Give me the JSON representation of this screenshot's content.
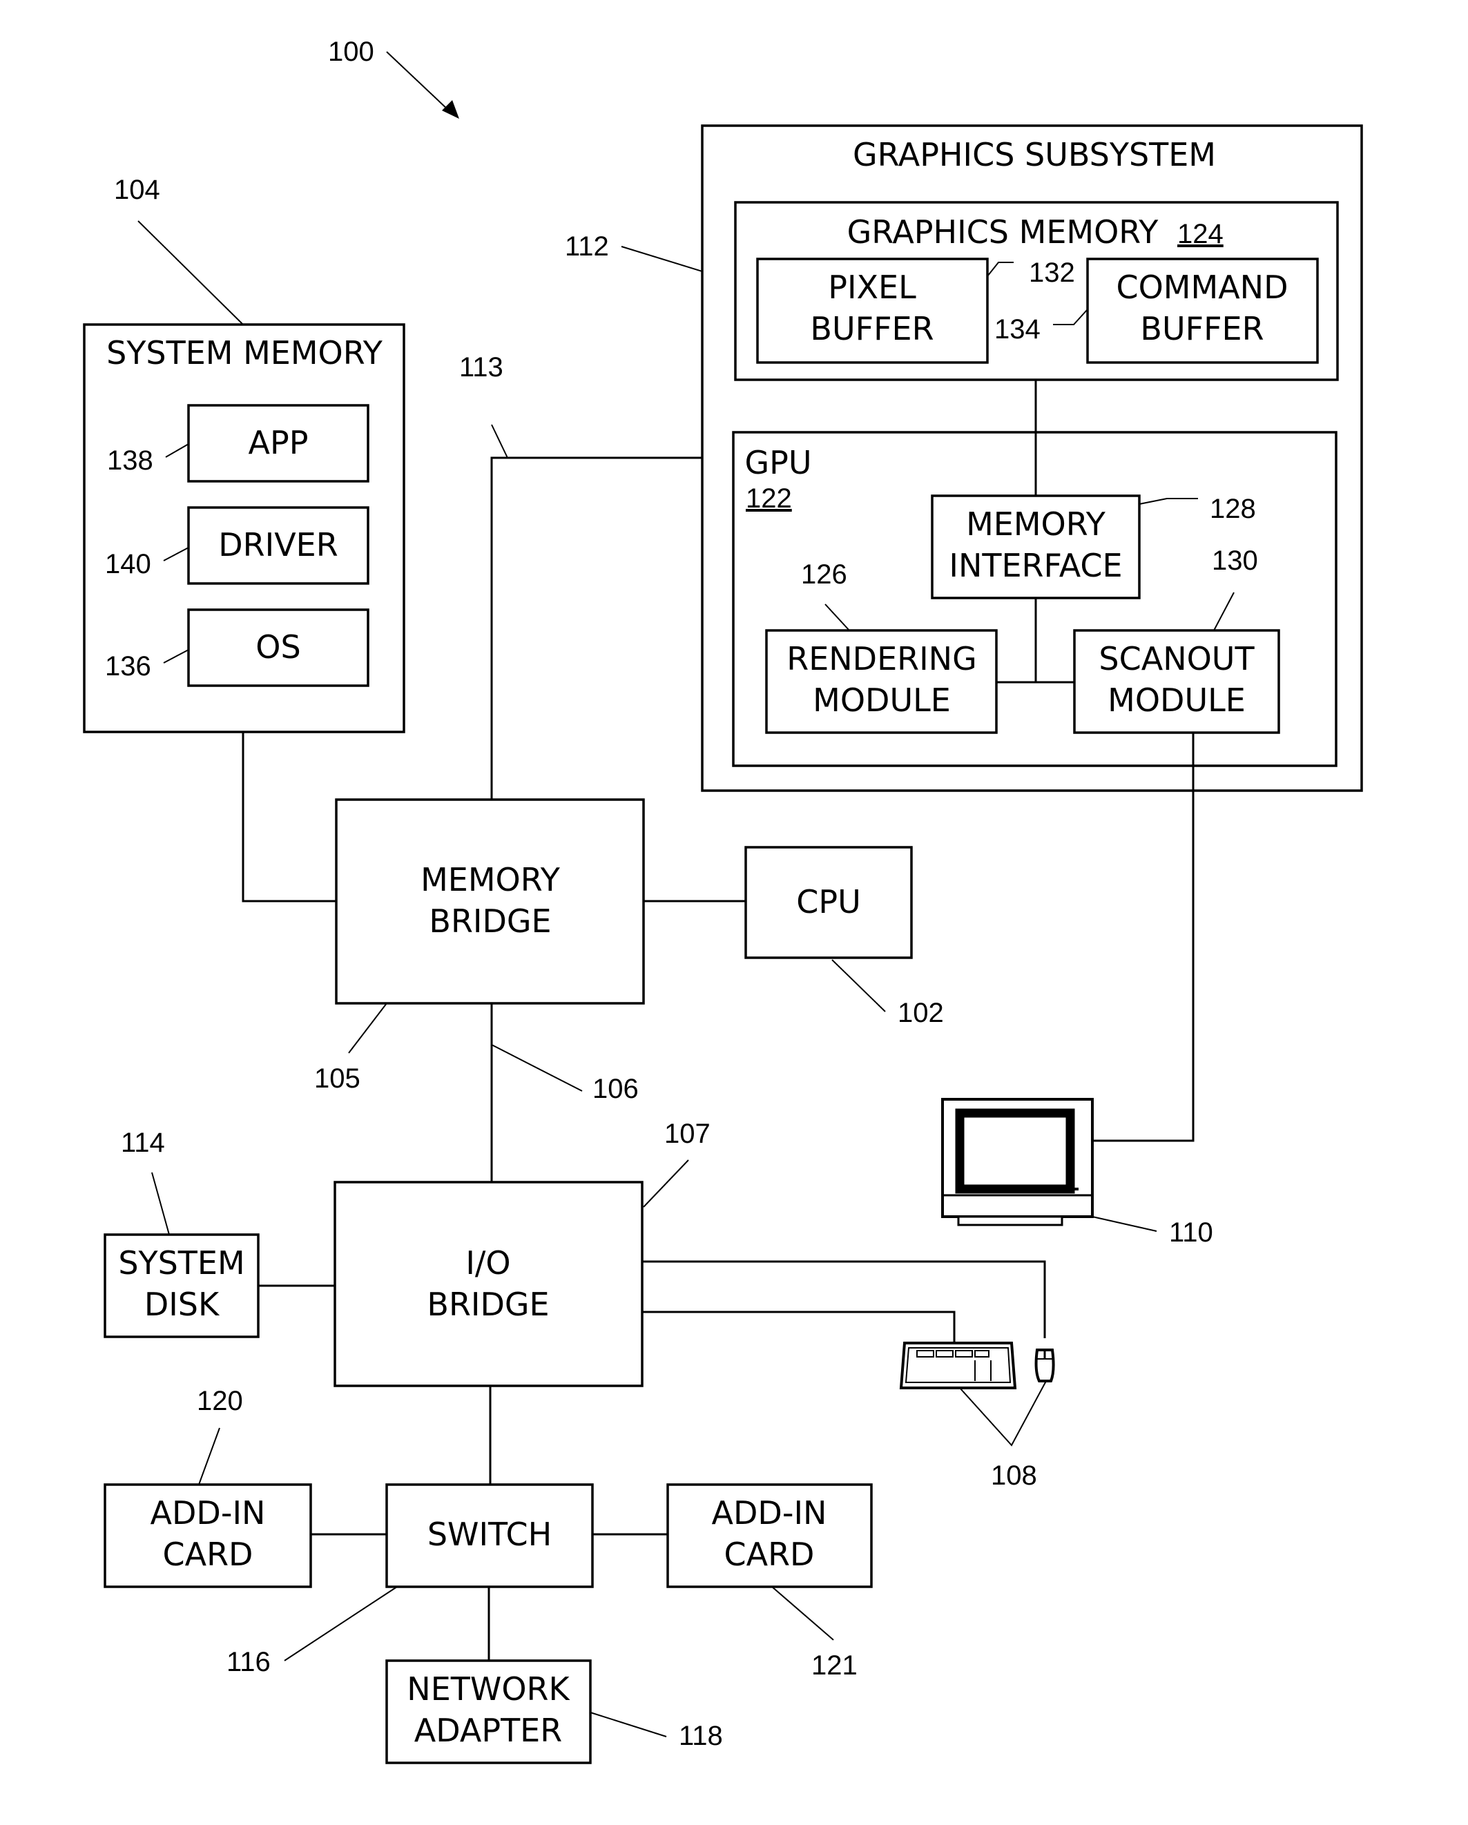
{
  "figure_ref": "100",
  "graphics_subsystem": {
    "title": "GRAPHICS SUBSYSTEM",
    "ref": "112"
  },
  "graphics_memory": {
    "title": "GRAPHICS MEMORY",
    "ref": "124"
  },
  "pixel_buffer": {
    "line1": "PIXEL",
    "line2": "BUFFER",
    "ref": "132"
  },
  "command_buffer": {
    "line1": "COMMAND",
    "line2": "BUFFER",
    "ref": "134"
  },
  "gpu": {
    "title": "GPU",
    "ref": "122"
  },
  "memory_interface": {
    "line1": "MEMORY",
    "line2": "INTERFACE",
    "ref": "128"
  },
  "rendering_module": {
    "line1": "RENDERING",
    "line2": "MODULE",
    "ref": "126"
  },
  "scanout_module": {
    "line1": "SCANOUT",
    "line2": "MODULE",
    "ref": "130"
  },
  "system_memory": {
    "title": "SYSTEM MEMORY",
    "ref": "104"
  },
  "app": {
    "label": "APP",
    "ref": "138"
  },
  "driver": {
    "label": "DRIVER",
    "ref": "140"
  },
  "os": {
    "label": "OS",
    "ref": "136"
  },
  "bus_113": {
    "ref": "113"
  },
  "memory_bridge": {
    "line1": "MEMORY",
    "line2": "BRIDGE",
    "ref": "105"
  },
  "cpu": {
    "label": "CPU",
    "ref": "102"
  },
  "bus_106": {
    "ref": "106"
  },
  "io_bridge": {
    "line1": "I/O",
    "line2": "BRIDGE",
    "ref": "107"
  },
  "system_disk": {
    "line1": "SYSTEM",
    "line2": "DISK",
    "ref": "114"
  },
  "display": {
    "ref": "110"
  },
  "input_devices": {
    "ref": "108"
  },
  "switch": {
    "label": "SWITCH",
    "ref": "116"
  },
  "add_in_card_left": {
    "line1": "ADD-IN",
    "line2": "CARD",
    "ref": "120"
  },
  "add_in_card_right": {
    "line1": "ADD-IN",
    "line2": "CARD",
    "ref": "121"
  },
  "network_adapter": {
    "line1": "NETWORK",
    "line2": "ADAPTER",
    "ref": "118"
  }
}
